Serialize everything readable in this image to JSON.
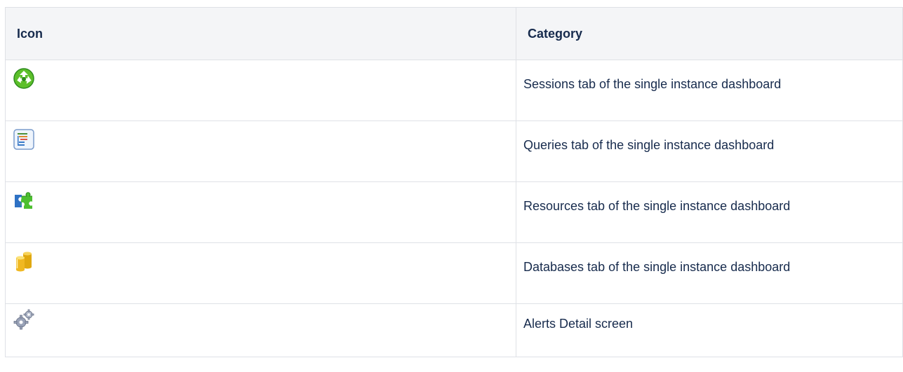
{
  "table": {
    "headers": {
      "icon": "Icon",
      "category": "Category"
    },
    "rows": [
      {
        "icon": "sessions-recycle-icon",
        "category": "Sessions tab of the single instance dashboard"
      },
      {
        "icon": "queries-list-icon",
        "category": "Queries tab of the single instance dashboard"
      },
      {
        "icon": "resources-puzzle-icon",
        "category": "Resources tab of the single instance dashboard"
      },
      {
        "icon": "databases-cylinder-icon",
        "category": "Databases tab of the single instance dashboard"
      },
      {
        "icon": "alerts-gears-icon",
        "category": "Alerts Detail screen"
      }
    ]
  },
  "colors": {
    "header_bg": "#f4f5f7",
    "border": "#dfe1e6",
    "text": "#172b4d"
  }
}
